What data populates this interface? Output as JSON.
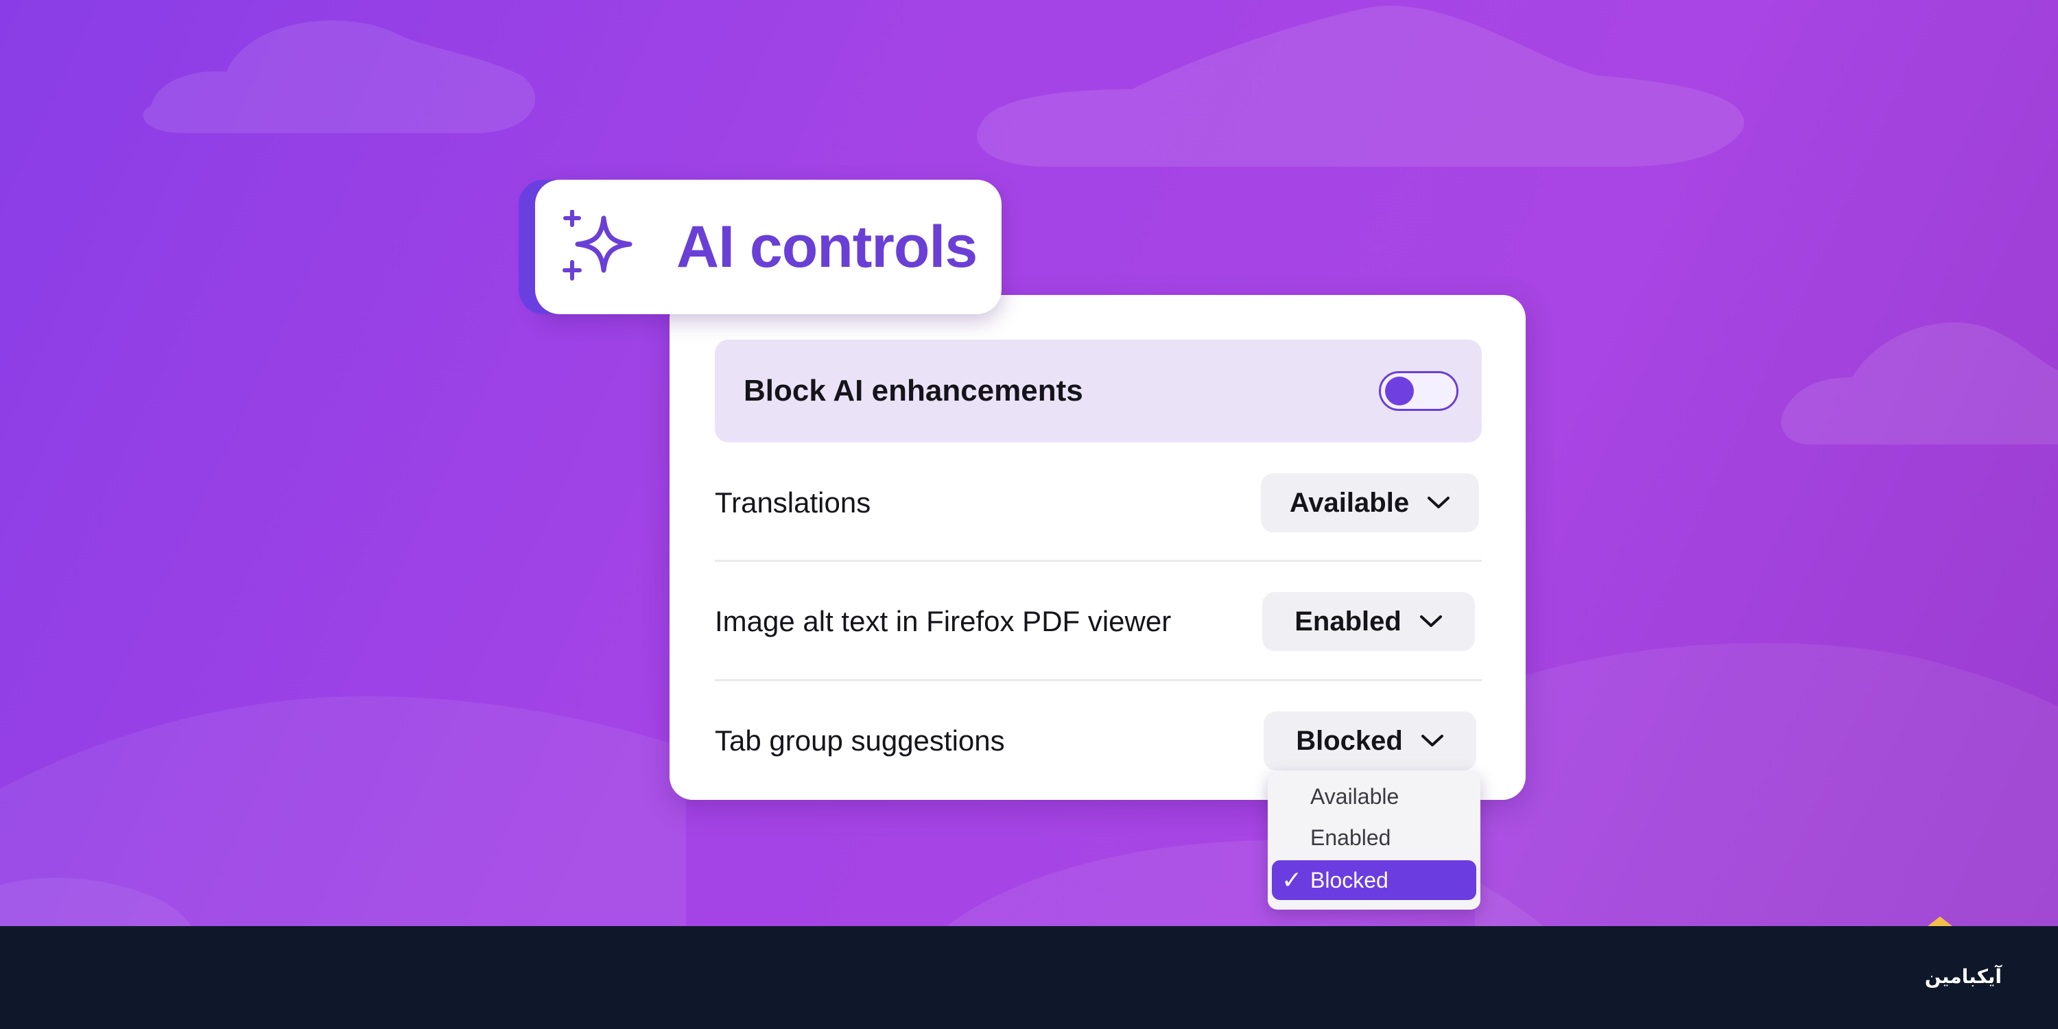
{
  "title_chip": {
    "title": "AI controls",
    "icon": "sparkle-icon"
  },
  "panel": {
    "block_toggle": {
      "label": "Block AI enhancements",
      "state": "off"
    },
    "rows": [
      {
        "label": "Translations",
        "value": "Available"
      },
      {
        "label": "Image alt text in Firefox PDF viewer",
        "value": "Enabled"
      },
      {
        "label": "Tab group suggestions",
        "value": "Blocked"
      }
    ]
  },
  "menu": {
    "options": [
      {
        "label": "Available",
        "selected": false
      },
      {
        "label": "Enabled",
        "selected": false
      },
      {
        "label": "Blocked",
        "selected": true
      }
    ],
    "check_glyph": "✓"
  },
  "footer": {
    "logo_text": "آیکبامین"
  },
  "colors": {
    "accent": "#6a3fd6",
    "background": "#a444e6",
    "footer": "#0f182a",
    "highlight_row": "#eae3f8"
  }
}
